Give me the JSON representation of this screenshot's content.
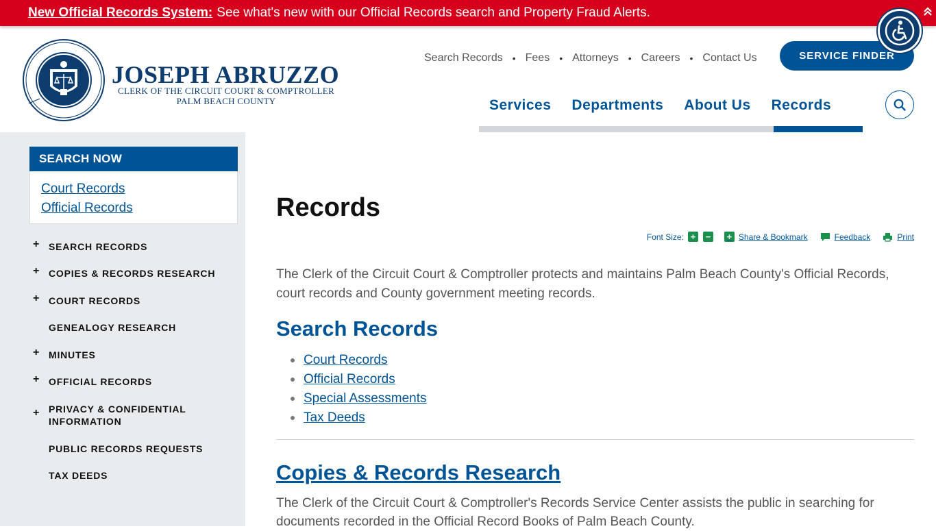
{
  "alert": {
    "link_text": "New Official Records System:",
    "text": "See what's new with our Official Records search and Property Fraud Alerts."
  },
  "brand": {
    "name": "JOSEPH ABRUZZO",
    "subtitle_1": "CLERK OF THE CIRCUIT COURT & COMPTROLLER",
    "subtitle_2": "PALM BEACH COUNTY",
    "seal_text": "CLERK OF THE CIRCUIT COURT & COMPTROLLER · PALM BEACH COUNTY"
  },
  "utility_nav": [
    "Search Records",
    "Fees",
    "Attorneys",
    "Careers",
    "Contact Us"
  ],
  "service_finder_label": "SERVICE FINDER",
  "main_nav": [
    "Services",
    "Departments",
    "About Us",
    "Records"
  ],
  "main_nav_active": "Records",
  "sidebar": {
    "search_now_title": "SEARCH NOW",
    "search_now_links": [
      "Court Records",
      "Official Records"
    ],
    "items": [
      {
        "label": "SEARCH RECORDS",
        "expandable": true
      },
      {
        "label": "COPIES & RECORDS RESEARCH",
        "expandable": true
      },
      {
        "label": "COURT RECORDS",
        "expandable": true
      },
      {
        "label": "GENEALOGY RESEARCH",
        "expandable": false
      },
      {
        "label": "MINUTES",
        "expandable": true
      },
      {
        "label": "OFFICIAL RECORDS",
        "expandable": true
      },
      {
        "label": "PRIVACY & CONFIDENTIAL INFORMATION",
        "expandable": true
      },
      {
        "label": "PUBLIC RECORDS REQUESTS",
        "expandable": false
      },
      {
        "label": "TAX DEEDS",
        "expandable": false
      }
    ]
  },
  "content": {
    "title": "Records",
    "tools": {
      "font_size_label": "Font Size:",
      "increase": "+",
      "decrease": "−",
      "share_label": "Share & Bookmark",
      "feedback_label": "Feedback",
      "print_label": "Print"
    },
    "intro": "The Clerk of the Circuit Court & Comptroller protects and maintains Palm Beach County's Official Records, court records and County government meeting records.",
    "search_heading": "Search Records",
    "search_links": [
      "Court Records",
      "Official Records",
      "Special Assessments",
      "Tax Deeds"
    ],
    "copies_heading": "Copies & Records Research",
    "copies_text": "The Clerk of the Circuit Court & Comptroller's Records Service Center assists the public in searching for documents recorded in the Official Record Books of Palm Beach County."
  },
  "colors": {
    "alert_red": "#d6001c",
    "brand_navy": "#0d3c6e",
    "link_blue": "#005496",
    "tool_green": "#1b8f4c",
    "sidebar_bg": "#e9ecef"
  },
  "icons": {
    "alert_collapse": "double-chevron-up-icon",
    "accessibility": "wheelchair-accessibility-icon",
    "search": "search-icon",
    "share": "plus-square-icon",
    "feedback": "speech-bubble-icon",
    "print": "printer-icon"
  }
}
